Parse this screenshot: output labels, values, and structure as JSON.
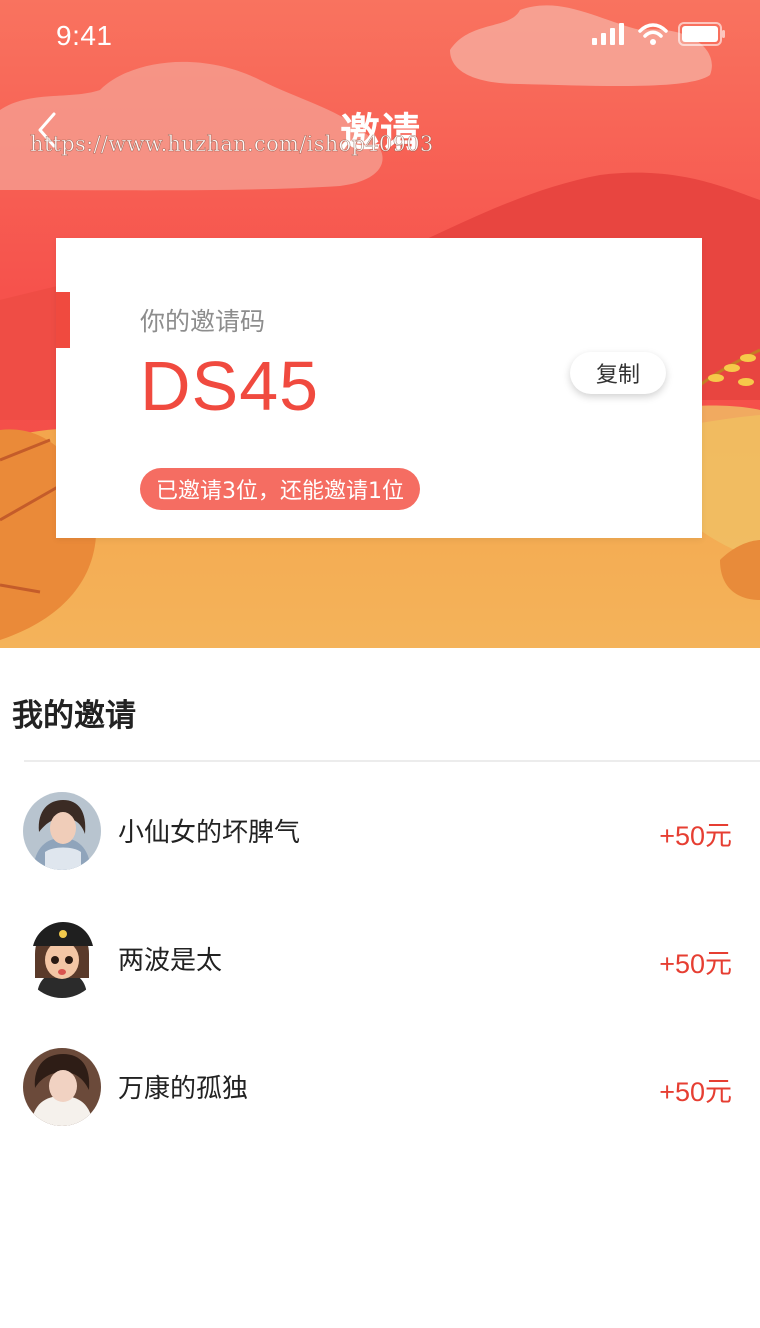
{
  "status_bar": {
    "time": "9:41"
  },
  "nav": {
    "title": "邀请"
  },
  "watermark": "https://www.huzhan.com/ishop40903",
  "invite_card": {
    "label": "你的邀请码",
    "code": "DS45",
    "copy_label": "复制",
    "status": "已邀请3位，还能邀请1位"
  },
  "my_invites": {
    "title": "我的邀请",
    "items": [
      {
        "name": "小仙女的坏脾气",
        "reward": "+50元"
      },
      {
        "name": "两波是太",
        "reward": "+50元"
      },
      {
        "name": "万康的孤独",
        "reward": "+50元"
      }
    ]
  },
  "colors": {
    "accent": "#f04a3f",
    "reward": "#e63e32",
    "badge": "#f56d62"
  }
}
